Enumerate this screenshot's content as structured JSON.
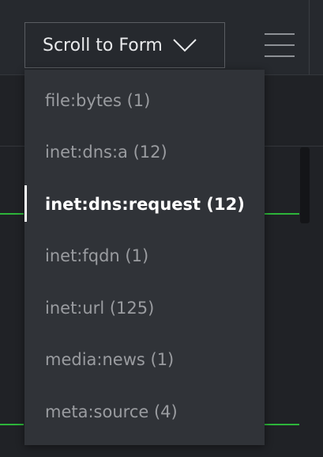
{
  "toolbar": {
    "scroll_button_label": "Scroll to Form",
    "scroll_button_icon": "chevron-down-icon",
    "menu_icon": "hamburger-menu-icon"
  },
  "dropdown": {
    "items": [
      {
        "label": "file:bytes (1)",
        "selected": false
      },
      {
        "label": "inet:dns:a (12)",
        "selected": false
      },
      {
        "label": "inet:dns:request (12)",
        "selected": true
      },
      {
        "label": "inet:fqdn (1)",
        "selected": false
      },
      {
        "label": "inet:url (125)",
        "selected": false
      },
      {
        "label": "media:news (1)",
        "selected": false
      },
      {
        "label": "meta:source (4)",
        "selected": false
      }
    ]
  },
  "colors": {
    "background": "#202226",
    "menu_background": "#303338",
    "text_muted": "#9a9ca0",
    "text_selected": "#ffffff",
    "accent_green": "#2db53a"
  }
}
